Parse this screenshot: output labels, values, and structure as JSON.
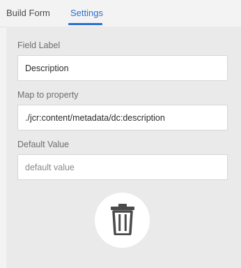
{
  "tabs": {
    "build_form": "Build Form",
    "settings": "Settings",
    "active": "settings"
  },
  "fields": {
    "field_label": {
      "label": "Field Label",
      "value": "Description"
    },
    "map_to_property": {
      "label": "Map to property",
      "value": "./jcr:content/metadata/dc:description"
    },
    "default_value": {
      "label": "Default Value",
      "value": "",
      "placeholder": "default value"
    }
  },
  "actions": {
    "delete_icon": "trash-icon"
  },
  "colors": {
    "accent": "#2c6fd1",
    "panel_background": "#eaeaea",
    "page_background": "#f3f3f3"
  }
}
